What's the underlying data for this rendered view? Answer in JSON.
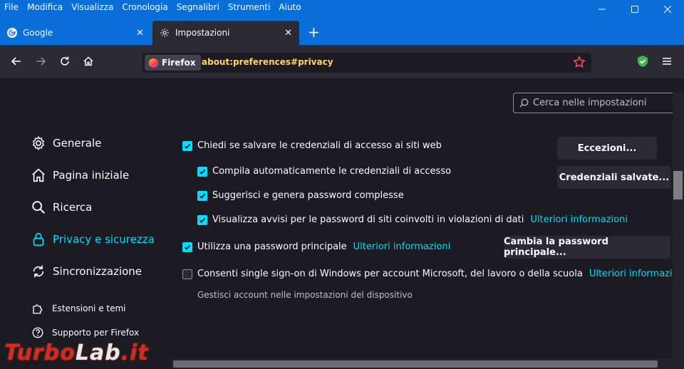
{
  "menu": [
    "File",
    "Modifica",
    "Visualizza",
    "Cronologia",
    "Segnalibri",
    "Strumenti",
    "Aiuto"
  ],
  "tabs": [
    {
      "label": "Google",
      "icon": "google-icon"
    },
    {
      "label": "Impostazioni",
      "icon": "gear-icon"
    }
  ],
  "urlbar": {
    "identity": "Firefox",
    "url": "about:preferences#privacy"
  },
  "search": {
    "placeholder": "Cerca nelle impostazioni"
  },
  "sidebar": {
    "items": [
      {
        "label": "Generale",
        "icon": "gear-icon"
      },
      {
        "label": "Pagina iniziale",
        "icon": "home-icon"
      },
      {
        "label": "Ricerca",
        "icon": "search-icon"
      },
      {
        "label": "Privacy e sicurezza",
        "icon": "lock-icon",
        "active": true
      },
      {
        "label": "Sincronizzazione",
        "icon": "sync-icon"
      }
    ],
    "footer": [
      {
        "label": "Estensioni e temi",
        "icon": "puzzle-icon"
      },
      {
        "label": "Supporto per Firefox",
        "icon": "help-icon"
      }
    ]
  },
  "logins": {
    "ask_save": {
      "label": "Chiedi se salvare le credenziali di accesso ai siti web",
      "checked": true
    },
    "autofill": {
      "label": "Compila automaticamente le credenziali di accesso",
      "checked": true
    },
    "suggest": {
      "label": "Suggerisci e genera password complesse",
      "checked": true
    },
    "breach": {
      "label": "Visualizza avvisi per le password di siti coinvolti in violazioni di dati",
      "checked": true,
      "link": "Ulteriori informazioni"
    },
    "primary": {
      "label": "Utilizza una password principale",
      "checked": true,
      "link": "Ulteriori informazioni"
    },
    "sso": {
      "label": "Consenti single sign-on di Windows per account Microsoft, del lavoro o della scuola",
      "checked": false,
      "link": "Ulteriori informazioni"
    },
    "sso_note": "Gestisci account nelle impostazioni del dispositivo",
    "exceptions_button": "Eccezioni...",
    "saved_button": "Credenziali salvate...",
    "change_primary_button": "Cambia la password principale..."
  },
  "watermark": {
    "part1": "Turbo",
    "part2": "Lab",
    "part3": ".it"
  },
  "colors": {
    "accent": "#00ddff",
    "titlebar": "#0a6ed8",
    "background": "#1c1b22",
    "url_text": "#ffd567"
  }
}
